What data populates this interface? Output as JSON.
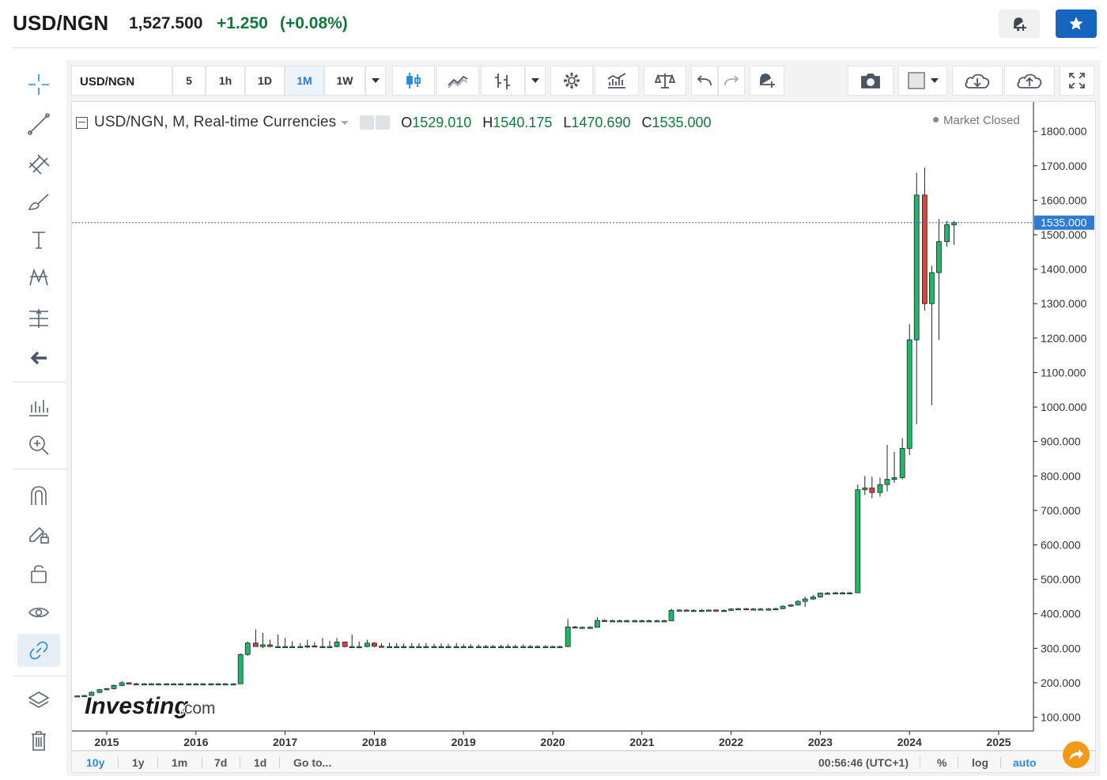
{
  "header": {
    "symbol": "USD/NGN",
    "price": "1,527.500",
    "change": "+1.250",
    "change_pct": "(+0.08%)",
    "colors": {
      "up": "#0f7a3c",
      "watch_button": "#1565c0"
    },
    "alert_icon": "bell-plus-icon",
    "watch_icon": "star-icon"
  },
  "toolbar": {
    "symbol": "USD/NGN",
    "intervals": [
      "5",
      "1h",
      "1D",
      "1M",
      "1W"
    ],
    "active_interval": "1M",
    "icons": [
      "candles-icon",
      "line-chart-icon",
      "bar-style-icon",
      "settings-gear-icon",
      "indicators-icon",
      "compare-scale-icon",
      "undo-icon",
      "redo-icon",
      "alert-add-icon",
      "camera-icon",
      "color-swatch-icon",
      "cloud-download-icon",
      "cloud-upload-icon",
      "fullscreen-icon"
    ]
  },
  "legend": {
    "title": "USD/NGN, M, Real-time Currencies",
    "o_label": "O",
    "o": "1529.010",
    "h_label": "H",
    "h": "1540.175",
    "l_label": "L",
    "l": "1470.690",
    "c_label": "C",
    "c": "1535.000",
    "status": "Market Closed"
  },
  "watermark": {
    "brand": "Investing",
    "suffix": ".com"
  },
  "bottombar": {
    "ranges": [
      "10y",
      "1y",
      "1m",
      "7d",
      "1d"
    ],
    "active_range": "10y",
    "goto": "Go to...",
    "clock": "00:56:46 (UTC+1)",
    "pct": "%",
    "log": "log",
    "auto": "auto"
  },
  "chart_data": {
    "type": "candlestick",
    "title": "USD/NGN, M, Real-time Currencies",
    "x_axis": {
      "ticks": [
        "2015",
        "2016",
        "2017",
        "2018",
        "2019",
        "2020",
        "2021",
        "2022",
        "2023",
        "2024",
        "2025"
      ]
    },
    "y_axis": {
      "ticks": [
        "100.000",
        "200.000",
        "300.000",
        "400.000",
        "500.000",
        "600.000",
        "700.000",
        "800.000",
        "900.000",
        "1000.000",
        "1100.000",
        "1200.000",
        "1300.000",
        "1400.000",
        "1500.000",
        "1600.000",
        "1700.000",
        "1800.000"
      ],
      "range": [
        60,
        1860
      ],
      "side": "right"
    },
    "last_price_label": "1535.000",
    "last_price": 1535,
    "colors": {
      "up": "#1fb86a",
      "down": "#e0413b",
      "last_line": "#3b5bdb",
      "last_label_bg": "#2e7bd6"
    },
    "grid": false,
    "candles": [
      {
        "t": 2014.58,
        "o": 160,
        "h": 162,
        "l": 158,
        "c": 161
      },
      {
        "t": 2014.67,
        "o": 161,
        "h": 163,
        "l": 159,
        "c": 162
      },
      {
        "t": 2014.75,
        "o": 162,
        "h": 165,
        "l": 160,
        "c": 163
      },
      {
        "t": 2014.83,
        "o": 163,
        "h": 176,
        "l": 162,
        "c": 172
      },
      {
        "t": 2014.92,
        "o": 172,
        "h": 182,
        "l": 170,
        "c": 180
      },
      {
        "t": 2015.0,
        "o": 180,
        "h": 185,
        "l": 178,
        "c": 183
      },
      {
        "t": 2015.08,
        "o": 183,
        "h": 195,
        "l": 180,
        "c": 192
      },
      {
        "t": 2015.17,
        "o": 192,
        "h": 205,
        "l": 190,
        "c": 200
      },
      {
        "t": 2015.25,
        "o": 200,
        "h": 201,
        "l": 195,
        "c": 196
      },
      {
        "t": 2015.33,
        "o": 196,
        "h": 200,
        "l": 195,
        "c": 197
      },
      {
        "t": 2015.42,
        "o": 197,
        "h": 199,
        "l": 196,
        "c": 197
      },
      {
        "t": 2015.5,
        "o": 197,
        "h": 199,
        "l": 196,
        "c": 197
      },
      {
        "t": 2015.58,
        "o": 197,
        "h": 199,
        "l": 196,
        "c": 197
      },
      {
        "t": 2015.67,
        "o": 197,
        "h": 199,
        "l": 196,
        "c": 197
      },
      {
        "t": 2015.75,
        "o": 197,
        "h": 199,
        "l": 196,
        "c": 197
      },
      {
        "t": 2015.83,
        "o": 197,
        "h": 199,
        "l": 196,
        "c": 197
      },
      {
        "t": 2015.92,
        "o": 197,
        "h": 199,
        "l": 196,
        "c": 197
      },
      {
        "t": 2016.0,
        "o": 197,
        "h": 199,
        "l": 196,
        "c": 197
      },
      {
        "t": 2016.08,
        "o": 197,
        "h": 199,
        "l": 196,
        "c": 197
      },
      {
        "t": 2016.17,
        "o": 197,
        "h": 199,
        "l": 196,
        "c": 197
      },
      {
        "t": 2016.25,
        "o": 197,
        "h": 199,
        "l": 196,
        "c": 197
      },
      {
        "t": 2016.33,
        "o": 197,
        "h": 199,
        "l": 196,
        "c": 197
      },
      {
        "t": 2016.42,
        "o": 197,
        "h": 199,
        "l": 196,
        "c": 197
      },
      {
        "t": 2016.5,
        "o": 197,
        "h": 285,
        "l": 197,
        "c": 282
      },
      {
        "t": 2016.58,
        "o": 282,
        "h": 320,
        "l": 278,
        "c": 315
      },
      {
        "t": 2016.67,
        "o": 315,
        "h": 355,
        "l": 305,
        "c": 305
      },
      {
        "t": 2016.75,
        "o": 305,
        "h": 345,
        "l": 300,
        "c": 310
      },
      {
        "t": 2016.83,
        "o": 310,
        "h": 325,
        "l": 303,
        "c": 305
      },
      {
        "t": 2016.92,
        "o": 305,
        "h": 340,
        "l": 303,
        "c": 305
      },
      {
        "t": 2017.0,
        "o": 305,
        "h": 330,
        "l": 303,
        "c": 305
      },
      {
        "t": 2017.08,
        "o": 305,
        "h": 320,
        "l": 303,
        "c": 305
      },
      {
        "t": 2017.17,
        "o": 305,
        "h": 315,
        "l": 303,
        "c": 305
      },
      {
        "t": 2017.25,
        "o": 305,
        "h": 325,
        "l": 300,
        "c": 307
      },
      {
        "t": 2017.33,
        "o": 307,
        "h": 318,
        "l": 304,
        "c": 305
      },
      {
        "t": 2017.42,
        "o": 305,
        "h": 330,
        "l": 303,
        "c": 305
      },
      {
        "t": 2017.5,
        "o": 305,
        "h": 322,
        "l": 303,
        "c": 305
      },
      {
        "t": 2017.58,
        "o": 305,
        "h": 330,
        "l": 303,
        "c": 318
      },
      {
        "t": 2017.67,
        "o": 318,
        "h": 320,
        "l": 303,
        "c": 305
      },
      {
        "t": 2017.75,
        "o": 305,
        "h": 340,
        "l": 303,
        "c": 305
      },
      {
        "t": 2017.83,
        "o": 305,
        "h": 320,
        "l": 300,
        "c": 305
      },
      {
        "t": 2017.92,
        "o": 305,
        "h": 325,
        "l": 303,
        "c": 315
      },
      {
        "t": 2018.0,
        "o": 315,
        "h": 318,
        "l": 303,
        "c": 306
      },
      {
        "t": 2018.08,
        "o": 306,
        "h": 315,
        "l": 304,
        "c": 305
      },
      {
        "t": 2018.17,
        "o": 305,
        "h": 316,
        "l": 303,
        "c": 305
      },
      {
        "t": 2018.25,
        "o": 305,
        "h": 315,
        "l": 303,
        "c": 305
      },
      {
        "t": 2018.33,
        "o": 305,
        "h": 314,
        "l": 303,
        "c": 305
      },
      {
        "t": 2018.42,
        "o": 305,
        "h": 315,
        "l": 303,
        "c": 305
      },
      {
        "t": 2018.5,
        "o": 305,
        "h": 315,
        "l": 303,
        "c": 305
      },
      {
        "t": 2018.58,
        "o": 305,
        "h": 315,
        "l": 303,
        "c": 305
      },
      {
        "t": 2018.67,
        "o": 305,
        "h": 313,
        "l": 303,
        "c": 305
      },
      {
        "t": 2018.75,
        "o": 305,
        "h": 314,
        "l": 303,
        "c": 305
      },
      {
        "t": 2018.83,
        "o": 305,
        "h": 313,
        "l": 303,
        "c": 305
      },
      {
        "t": 2018.92,
        "o": 305,
        "h": 315,
        "l": 303,
        "c": 305
      },
      {
        "t": 2019.0,
        "o": 305,
        "h": 312,
        "l": 303,
        "c": 305
      },
      {
        "t": 2019.08,
        "o": 305,
        "h": 312,
        "l": 303,
        "c": 305
      },
      {
        "t": 2019.17,
        "o": 305,
        "h": 311,
        "l": 303,
        "c": 305
      },
      {
        "t": 2019.25,
        "o": 305,
        "h": 310,
        "l": 303,
        "c": 305
      },
      {
        "t": 2019.33,
        "o": 305,
        "h": 310,
        "l": 303,
        "c": 305
      },
      {
        "t": 2019.42,
        "o": 305,
        "h": 310,
        "l": 303,
        "c": 305
      },
      {
        "t": 2019.5,
        "o": 305,
        "h": 312,
        "l": 303,
        "c": 305
      },
      {
        "t": 2019.58,
        "o": 305,
        "h": 310,
        "l": 303,
        "c": 305
      },
      {
        "t": 2019.67,
        "o": 305,
        "h": 311,
        "l": 303,
        "c": 305
      },
      {
        "t": 2019.75,
        "o": 305,
        "h": 310,
        "l": 303,
        "c": 305
      },
      {
        "t": 2019.83,
        "o": 305,
        "h": 309,
        "l": 303,
        "c": 305
      },
      {
        "t": 2019.92,
        "o": 305,
        "h": 309,
        "l": 303,
        "c": 305
      },
      {
        "t": 2020.0,
        "o": 305,
        "h": 308,
        "l": 303,
        "c": 305
      },
      {
        "t": 2020.08,
        "o": 305,
        "h": 308,
        "l": 303,
        "c": 305
      },
      {
        "t": 2020.17,
        "o": 305,
        "h": 385,
        "l": 303,
        "c": 362
      },
      {
        "t": 2020.25,
        "o": 362,
        "h": 365,
        "l": 358,
        "c": 360
      },
      {
        "t": 2020.33,
        "o": 360,
        "h": 363,
        "l": 358,
        "c": 361
      },
      {
        "t": 2020.42,
        "o": 361,
        "h": 364,
        "l": 358,
        "c": 361
      },
      {
        "t": 2020.5,
        "o": 361,
        "h": 390,
        "l": 360,
        "c": 381
      },
      {
        "t": 2020.58,
        "o": 381,
        "h": 384,
        "l": 378,
        "c": 380
      },
      {
        "t": 2020.67,
        "o": 380,
        "h": 383,
        "l": 378,
        "c": 380
      },
      {
        "t": 2020.75,
        "o": 380,
        "h": 383,
        "l": 378,
        "c": 380
      },
      {
        "t": 2020.83,
        "o": 380,
        "h": 383,
        "l": 378,
        "c": 380
      },
      {
        "t": 2020.92,
        "o": 380,
        "h": 383,
        "l": 378,
        "c": 380
      },
      {
        "t": 2021.0,
        "o": 380,
        "h": 383,
        "l": 378,
        "c": 380
      },
      {
        "t": 2021.08,
        "o": 380,
        "h": 383,
        "l": 378,
        "c": 380
      },
      {
        "t": 2021.17,
        "o": 380,
        "h": 383,
        "l": 378,
        "c": 380
      },
      {
        "t": 2021.25,
        "o": 380,
        "h": 383,
        "l": 378,
        "c": 380
      },
      {
        "t": 2021.33,
        "o": 380,
        "h": 415,
        "l": 379,
        "c": 410
      },
      {
        "t": 2021.42,
        "o": 410,
        "h": 413,
        "l": 408,
        "c": 411
      },
      {
        "t": 2021.5,
        "o": 411,
        "h": 413,
        "l": 408,
        "c": 410
      },
      {
        "t": 2021.58,
        "o": 410,
        "h": 413,
        "l": 408,
        "c": 410
      },
      {
        "t": 2021.67,
        "o": 410,
        "h": 414,
        "l": 407,
        "c": 410
      },
      {
        "t": 2021.75,
        "o": 410,
        "h": 413,
        "l": 408,
        "c": 411
      },
      {
        "t": 2021.83,
        "o": 411,
        "h": 413,
        "l": 408,
        "c": 410
      },
      {
        "t": 2021.92,
        "o": 410,
        "h": 413,
        "l": 408,
        "c": 410
      },
      {
        "t": 2022.0,
        "o": 410,
        "h": 416,
        "l": 408,
        "c": 414
      },
      {
        "t": 2022.08,
        "o": 414,
        "h": 417,
        "l": 412,
        "c": 415
      },
      {
        "t": 2022.17,
        "o": 415,
        "h": 417,
        "l": 412,
        "c": 414
      },
      {
        "t": 2022.25,
        "o": 414,
        "h": 417,
        "l": 412,
        "c": 414
      },
      {
        "t": 2022.33,
        "o": 414,
        "h": 417,
        "l": 412,
        "c": 414
      },
      {
        "t": 2022.42,
        "o": 414,
        "h": 417,
        "l": 412,
        "c": 414
      },
      {
        "t": 2022.5,
        "o": 414,
        "h": 418,
        "l": 412,
        "c": 415
      },
      {
        "t": 2022.58,
        "o": 415,
        "h": 425,
        "l": 413,
        "c": 422
      },
      {
        "t": 2022.67,
        "o": 422,
        "h": 428,
        "l": 420,
        "c": 426
      },
      {
        "t": 2022.75,
        "o": 426,
        "h": 440,
        "l": 424,
        "c": 436
      },
      {
        "t": 2022.83,
        "o": 436,
        "h": 450,
        "l": 420,
        "c": 443
      },
      {
        "t": 2022.92,
        "o": 443,
        "h": 455,
        "l": 440,
        "c": 449
      },
      {
        "t": 2023.0,
        "o": 449,
        "h": 462,
        "l": 447,
        "c": 460
      },
      {
        "t": 2023.08,
        "o": 460,
        "h": 463,
        "l": 458,
        "c": 460
      },
      {
        "t": 2023.17,
        "o": 460,
        "h": 464,
        "l": 458,
        "c": 461
      },
      {
        "t": 2023.25,
        "o": 461,
        "h": 464,
        "l": 458,
        "c": 461
      },
      {
        "t": 2023.33,
        "o": 461,
        "h": 464,
        "l": 458,
        "c": 461
      },
      {
        "t": 2023.42,
        "o": 461,
        "h": 775,
        "l": 460,
        "c": 760
      },
      {
        "t": 2023.5,
        "o": 760,
        "h": 800,
        "l": 745,
        "c": 765
      },
      {
        "t": 2023.58,
        "o": 765,
        "h": 798,
        "l": 735,
        "c": 752
      },
      {
        "t": 2023.67,
        "o": 752,
        "h": 795,
        "l": 740,
        "c": 775
      },
      {
        "t": 2023.75,
        "o": 775,
        "h": 890,
        "l": 755,
        "c": 790
      },
      {
        "t": 2023.83,
        "o": 790,
        "h": 870,
        "l": 780,
        "c": 795
      },
      {
        "t": 2023.92,
        "o": 795,
        "h": 910,
        "l": 790,
        "c": 880
      },
      {
        "t": 2024.0,
        "o": 880,
        "h": 1240,
        "l": 860,
        "c": 1195
      },
      {
        "t": 2024.08,
        "o": 1195,
        "h": 1680,
        "l": 950,
        "c": 1615
      },
      {
        "t": 2024.17,
        "o": 1615,
        "h": 1695,
        "l": 1280,
        "c": 1300
      },
      {
        "t": 2024.25,
        "o": 1300,
        "h": 1410,
        "l": 1005,
        "c": 1390
      },
      {
        "t": 2024.33,
        "o": 1390,
        "h": 1545,
        "l": 1195,
        "c": 1480
      },
      {
        "t": 2024.42,
        "o": 1480,
        "h": 1540,
        "l": 1465,
        "c": 1529
      },
      {
        "t": 2024.5,
        "o": 1529.01,
        "h": 1540.175,
        "l": 1470.69,
        "c": 1535
      }
    ]
  }
}
